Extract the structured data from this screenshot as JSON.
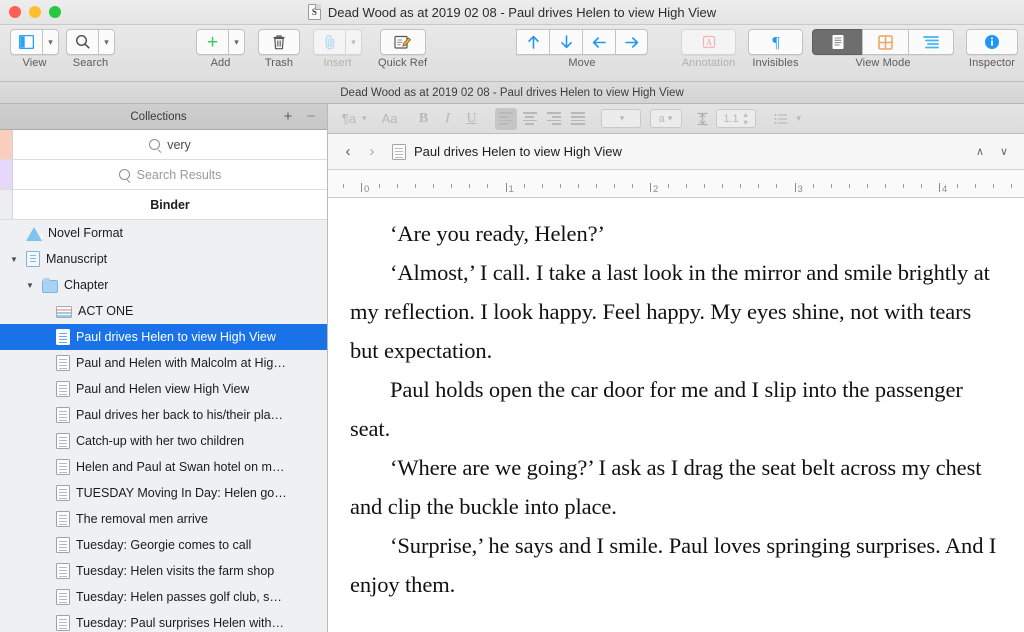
{
  "window": {
    "title": "Dead Wood as at 2019 02 08 - Paul drives Helen to view High View",
    "doc_icon": "S",
    "subtitle": "Dead Wood as at 2019 02 08 - Paul drives Helen to view High View"
  },
  "toolbar": {
    "groups": [
      {
        "label": "View",
        "name": "view",
        "dim": false
      },
      {
        "label": "Search",
        "name": "search",
        "dim": false
      },
      {
        "label": "Add",
        "name": "add",
        "dim": false
      },
      {
        "label": "Trash",
        "name": "trash",
        "dim": false
      },
      {
        "label": "Insert",
        "name": "insert",
        "dim": true
      },
      {
        "label": "Quick Ref",
        "name": "quick-ref",
        "dim": false
      },
      {
        "label": "Move",
        "name": "move",
        "dim": false
      },
      {
        "label": "Annotation",
        "name": "annotation",
        "dim": true
      },
      {
        "label": "Invisibles",
        "name": "invisibles",
        "dim": false
      },
      {
        "label": "View Mode",
        "name": "view-mode",
        "dim": false
      },
      {
        "label": "Inspector",
        "name": "inspector",
        "dim": false
      }
    ],
    "labels": {
      "view": "View",
      "search": "Search",
      "add": "Add",
      "trash": "Trash",
      "insert": "Insert",
      "quick_ref": "Quick Ref",
      "move": "Move",
      "annotation": "Annotation",
      "invisibles": "Invisibles",
      "view_mode": "View Mode",
      "inspector": "Inspector"
    },
    "icons": {
      "view": "sidebar-icon",
      "search": "magnifier-icon",
      "add": "plus-icon",
      "trash": "trash-icon",
      "insert": "paperclip-icon",
      "quick_ref": "note-pencil-icon",
      "move_up": "arrow-up-icon",
      "move_down": "arrow-down-icon",
      "move_left": "arrow-left-icon",
      "move_right": "arrow-right-icon",
      "annotation": "letter-a-box-icon",
      "invisibles": "pilcrow-icon",
      "view_mode_document": "document-view-icon",
      "view_mode_corkboard": "corkboard-grid-icon",
      "view_mode_outliner": "outliner-lines-icon",
      "inspector": "info-circle-icon"
    },
    "accents": {
      "blue": "#2196f3",
      "green": "#34c759",
      "orange": "#f0a35e",
      "active_bg": "#6e6e6e"
    }
  },
  "sidebar": {
    "header": {
      "title": "Collections",
      "add": "+",
      "remove": "−"
    },
    "collections": [
      {
        "label": "very",
        "strip": "#fbcfc0",
        "style": "value",
        "icon": "magnifier-icon"
      },
      {
        "label": "Search Results",
        "strip": "#e7d8fb",
        "style": "placeholder",
        "icon": "magnifier-icon"
      },
      {
        "label": "Binder",
        "strip": "#eceef1",
        "style": "bold",
        "icon": "none"
      }
    ],
    "binder": [
      {
        "label": "Novel Format",
        "icon": "info-triangle-icon",
        "indent": 1,
        "disclosure": "none",
        "selected": false
      },
      {
        "label": "Manuscript",
        "icon": "manuscript-icon",
        "indent": 1,
        "disclosure": "open",
        "selected": false
      },
      {
        "label": "Chapter",
        "icon": "folder-icon",
        "indent": 2,
        "disclosure": "open",
        "selected": false
      },
      {
        "label": "ACT ONE",
        "icon": "index-card-icon",
        "indent": 3,
        "disclosure": "none",
        "selected": false
      },
      {
        "label": "Paul drives Helen to view High View",
        "icon": "document-icon",
        "indent": 3,
        "disclosure": "none",
        "selected": true
      },
      {
        "label": "Paul and Helen with Malcolm at Hig…",
        "icon": "document-icon",
        "indent": 3,
        "disclosure": "none",
        "selected": false
      },
      {
        "label": "Paul and Helen view High View",
        "icon": "document-icon",
        "indent": 3,
        "disclosure": "none",
        "selected": false
      },
      {
        "label": "Paul drives her back to his/their pla…",
        "icon": "document-icon",
        "indent": 3,
        "disclosure": "none",
        "selected": false
      },
      {
        "label": "Catch-up with her two children",
        "icon": "document-icon",
        "indent": 3,
        "disclosure": "none",
        "selected": false
      },
      {
        "label": "Helen and Paul at Swan hotel on m…",
        "icon": "document-icon",
        "indent": 3,
        "disclosure": "none",
        "selected": false
      },
      {
        "label": "TUESDAY Moving In Day: Helen go…",
        "icon": "document-icon",
        "indent": 3,
        "disclosure": "none",
        "selected": false
      },
      {
        "label": "The removal men arrive",
        "icon": "document-icon",
        "indent": 3,
        "disclosure": "none",
        "selected": false
      },
      {
        "label": "Tuesday: Georgie comes to call",
        "icon": "document-icon",
        "indent": 3,
        "disclosure": "none",
        "selected": false
      },
      {
        "label": "Tuesday: Helen visits the farm shop",
        "icon": "document-icon",
        "indent": 3,
        "disclosure": "none",
        "selected": false
      },
      {
        "label": "Tuesday: Helen passes golf club, s…",
        "icon": "document-icon",
        "indent": 3,
        "disclosure": "none",
        "selected": false
      },
      {
        "label": "Tuesday: Paul surprises Helen with…",
        "icon": "document-icon",
        "indent": 3,
        "disclosure": "none",
        "selected": false
      }
    ],
    "selection_color": "#1a72e8"
  },
  "format_bar": {
    "paragraph_style": "¶a",
    "font_panel": "Aa",
    "bold": "B",
    "italic": "I",
    "underline": "U",
    "font_select": "",
    "size_select": "a",
    "line_spacing": "1.1",
    "list": "list-icon",
    "enabled": false
  },
  "editor_header": {
    "back": "‹",
    "forward": "›",
    "icon": "document-icon",
    "title": "Paul drives Helen to view High View",
    "up": "∧",
    "down": "∨"
  },
  "ruler": {
    "unit_labels": [
      "0",
      "1",
      "2",
      "3",
      "4"
    ],
    "visible": true
  },
  "document": {
    "paragraphs": [
      "‘Are you ready, Helen?’",
      "‘Almost,’ I call. I take a last look in the mirror and smile brightly at my reflection. I look happy. Feel happy. My eyes shine, not with tears but expectation.",
      "Paul holds open the car door for me and I slip into the passenger seat.",
      "‘Where are we going?’ I ask as I drag the seat belt across my chest and clip the buckle into place.",
      "‘Surprise,’ he says and I smile. Paul loves springing surprises. And I enjoy them."
    ]
  }
}
